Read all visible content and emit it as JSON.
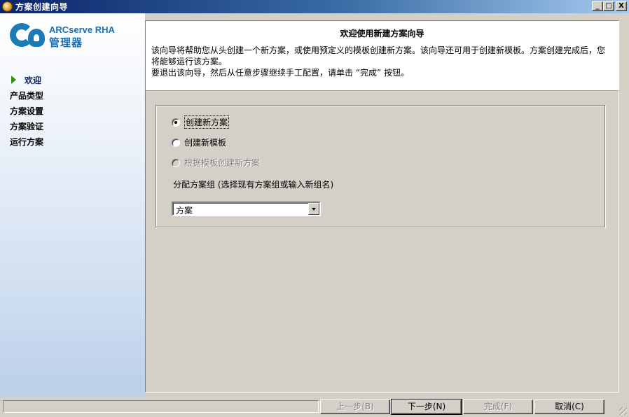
{
  "window": {
    "title": "方案创建向导",
    "minimize": "_",
    "maximize": "□",
    "close": "X"
  },
  "sidebar": {
    "logo": {
      "brand_line1": "ARCserve RHA",
      "brand_line2": "管理器"
    },
    "steps": [
      {
        "label": "欢迎",
        "active": true
      },
      {
        "label": "产品类型",
        "active": false
      },
      {
        "label": "方案设置",
        "active": false
      },
      {
        "label": "方案验证",
        "active": false
      },
      {
        "label": "运行方案",
        "active": false
      }
    ]
  },
  "header": {
    "title": "欢迎使用新建方案向导",
    "line1": "该向导将帮助您从头创建一个新方案，或使用预定义的模板创建新方案。该向导还可用于创建新模板。方案创建完成后，您将能够运行该方案。",
    "line2": "要退出该向导，然后从任意步骤继续手工配置，请单击 “完成” 按钮。"
  },
  "options": {
    "radios": [
      {
        "label": "创建新方案",
        "checked": true,
        "disabled": false
      },
      {
        "label": "创建新模板",
        "checked": false,
        "disabled": false
      },
      {
        "label": "根据模板创建新方案",
        "checked": false,
        "disabled": true
      }
    ],
    "group_label": "分配方案组 (选择现有方案组或输入新组名)",
    "group_value": "方案"
  },
  "buttons": {
    "back": "上一步(B)",
    "next": "下一步(N)",
    "finish": "完成(F)",
    "cancel": "取消(C)"
  }
}
